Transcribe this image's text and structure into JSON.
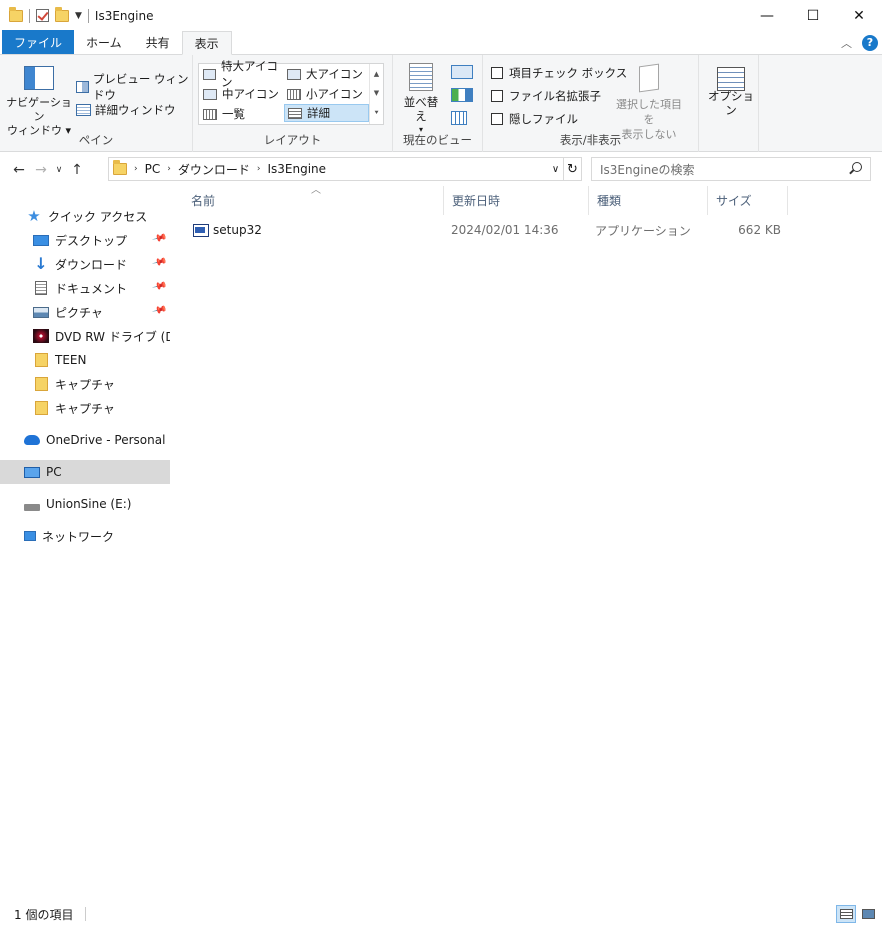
{
  "window": {
    "title": "Is3Engine",
    "buttons": {
      "minimize": "—",
      "maximize": "☐",
      "close": "✕"
    }
  },
  "tabs": [
    {
      "label": "ファイル"
    },
    {
      "label": "ホーム"
    },
    {
      "label": "共有"
    },
    {
      "label": "表示"
    }
  ],
  "ribbon": {
    "pane": {
      "navigation_pane": "ナビゲーション\nウィンドウ ▾",
      "preview_pane": "プレビュー ウィンドウ",
      "details_pane": "詳細ウィンドウ",
      "label": "ペイン"
    },
    "layout": {
      "items": [
        "特大アイコン",
        "大アイコン",
        "中アイコン",
        "小アイコン",
        "一覧",
        "詳細"
      ],
      "selected": "詳細",
      "label": "レイアウト"
    },
    "current_view": {
      "sort": "並べ替え",
      "label": "現在のビュー"
    },
    "show_hide": {
      "item_checkboxes": "項目チェック ボックス",
      "file_extensions": "ファイル名拡張子",
      "hidden_items": "隠しファイル",
      "hide_selected": "選択した項目を\n表示しない",
      "label": "表示/非表示"
    },
    "options": "オプション"
  },
  "address": {
    "crumbs": [
      "PC",
      "ダウンロード",
      "Is3Engine"
    ],
    "search_placeholder": "Is3Engineの検索"
  },
  "nav": {
    "quick_access": "クイック アクセス",
    "items": [
      {
        "label": "デスクトップ",
        "pinned": true
      },
      {
        "label": "ダウンロード",
        "pinned": true
      },
      {
        "label": "ドキュメント",
        "pinned": true
      },
      {
        "label": "ピクチャ",
        "pinned": true
      },
      {
        "label": "DVD RW ドライブ (D:) TE",
        "pinned": false
      },
      {
        "label": "TEEN",
        "pinned": false
      },
      {
        "label": "キャプチャ",
        "pinned": false
      },
      {
        "label": "キャプチャ",
        "pinned": false
      }
    ],
    "onedrive": "OneDrive - Personal",
    "pc": "PC",
    "drive_e": "UnionSine (E:)",
    "network": "ネットワーク"
  },
  "columns": [
    "名前",
    "更新日時",
    "種類",
    "サイズ"
  ],
  "files": [
    {
      "name": "setup32",
      "modified": "2024/02/01 14:36",
      "type": "アプリケーション",
      "size": "662 KB"
    }
  ],
  "status": {
    "count": "1 個の項目"
  }
}
